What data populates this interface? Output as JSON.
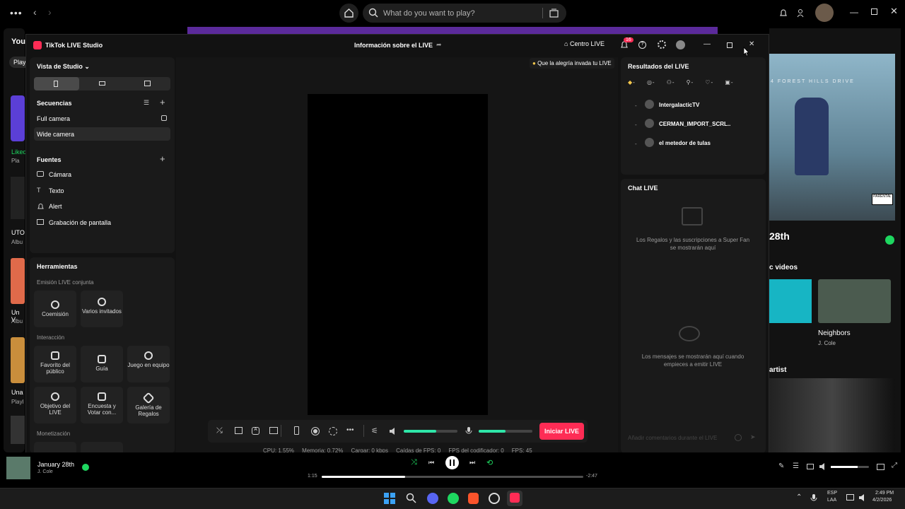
{
  "spotify": {
    "search_placeholder": "What do you want to play?",
    "lib_title": "Your",
    "lib_filter": "Play",
    "lib_items": [
      "Liked",
      "Pla",
      "UTO",
      "Albu",
      "Un V",
      "Albu",
      "Una",
      "Playl"
    ],
    "right": {
      "album_banner": "4 FOREST HILLS DRIVE",
      "track_title": "28th",
      "videos_heading": "c videos",
      "video_title": "Neighbors",
      "video_artist": "J. Cole",
      "artist_heading": "artist"
    },
    "now_playing": {
      "title": "January 28th",
      "artist": "J. Cole"
    },
    "time_elapsed": "1:15",
    "time_remaining": "-2:47",
    "progress": 0.32
  },
  "tiktok": {
    "app_title": "TikTok LIVE Studio",
    "center_title": "Información sobre el LIVE",
    "centro_live": "Centro LIVE",
    "notif_count": "16",
    "studio_view": "Vista de Studio",
    "sequences": {
      "heading": "Secuencias",
      "items": [
        "Full camera",
        "Wide camera"
      ]
    },
    "sources": {
      "heading": "Fuentes",
      "items": [
        "Cámara",
        "Texto",
        "Alert",
        "Grabación de pantalla"
      ]
    },
    "tools": {
      "heading": "Herramientas",
      "joint_heading": "Emisión LIVE conjunta",
      "joint": [
        "Coemisión",
        "Varios invitados"
      ],
      "interaction_heading": "Interacción",
      "interaction": [
        "Favorito del público",
        "Guía",
        "Juego en equipo",
        "Objetivo del LIVE",
        "Encuesta y Votar con...",
        "Galería de Regalos"
      ],
      "monetization_heading": "Monetización"
    },
    "tip": "Que la alegría invada tu LIVE",
    "results": {
      "heading": "Resultados del LIVE",
      "users": [
        "IntergalacticTV",
        "CERMAN_IMPORT_SCRL..",
        "el metedor de tulas"
      ]
    },
    "chat": {
      "heading": "Chat LIVE",
      "gifts_msg": "Los Regalos y las suscripciones a Super Fan se mostrarán aquí",
      "messages_msg": "Los mensajes se mostrarán aquí cuando empieces a emitir LIVE",
      "input_placeholder": "Añadir comentarios durante el LIVE"
    },
    "start_button": "Iniciar LIVE",
    "stats": {
      "cpu": "CPU: 1.55%",
      "memory": "Memoria: 0.72%",
      "upload": "Cargar: 0 kbps",
      "fps_drops": "Caídas de FPS: 0",
      "encoder_fps": "FPS del codificador: 0",
      "fps": "FPS: 45"
    },
    "volume_level": 0.6,
    "mic_level": 0.5
  },
  "taskbar": {
    "lang": "ESP",
    "lang2": "LAA",
    "time": "2:49 PM",
    "date": "4/2/2026"
  },
  "colors": {
    "accent": "#fe2c55",
    "green": "#1ed760",
    "tiktok_bg": "#121212"
  }
}
